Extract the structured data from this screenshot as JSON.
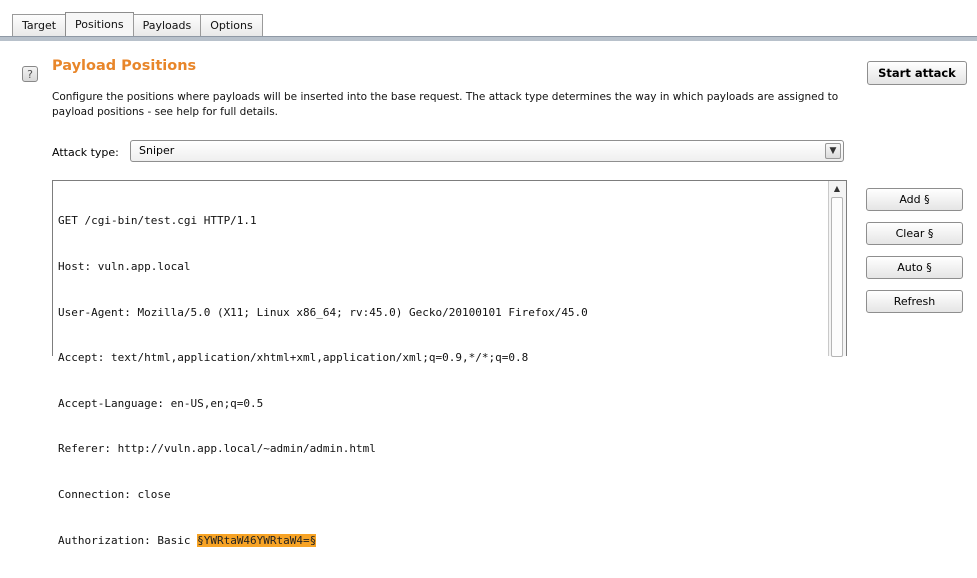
{
  "tabs": [
    {
      "label": "Target",
      "active": false
    },
    {
      "label": "Positions",
      "active": true
    },
    {
      "label": "Payloads",
      "active": false
    },
    {
      "label": "Options",
      "active": false
    }
  ],
  "help_icon": "help-icon",
  "section": {
    "title": "Payload Positions",
    "description": "Configure the positions where payloads will be inserted into the base request. The attack type determines the way in which payloads are assigned to payload positions - see help for full details."
  },
  "start_attack_label": "Start attack",
  "attack_type": {
    "label": "Attack type:",
    "value": "Sniper"
  },
  "request": {
    "lines": [
      "GET /cgi-bin/test.cgi HTTP/1.1",
      "Host: vuln.app.local",
      "User-Agent: Mozilla/5.0 (X11; Linux x86_64; rv:45.0) Gecko/20100101 Firefox/45.0",
      "Accept: text/html,application/xhtml+xml,application/xml;q=0.9,*/*;q=0.8",
      "Accept-Language: en-US,en;q=0.5",
      "Referer: http://vuln.app.local/~admin/admin.html",
      "Connection: close"
    ],
    "auth_prefix": "Authorization: Basic ",
    "payload_marker": "§YWRtaW46YWRtaW4=§"
  },
  "side_buttons": {
    "add": "Add §",
    "clear": "Clear §",
    "auto": "Auto §",
    "refresh": "Refresh"
  },
  "colors": {
    "title_orange": "#e8862a",
    "payload_highlight": "#f7a325"
  }
}
